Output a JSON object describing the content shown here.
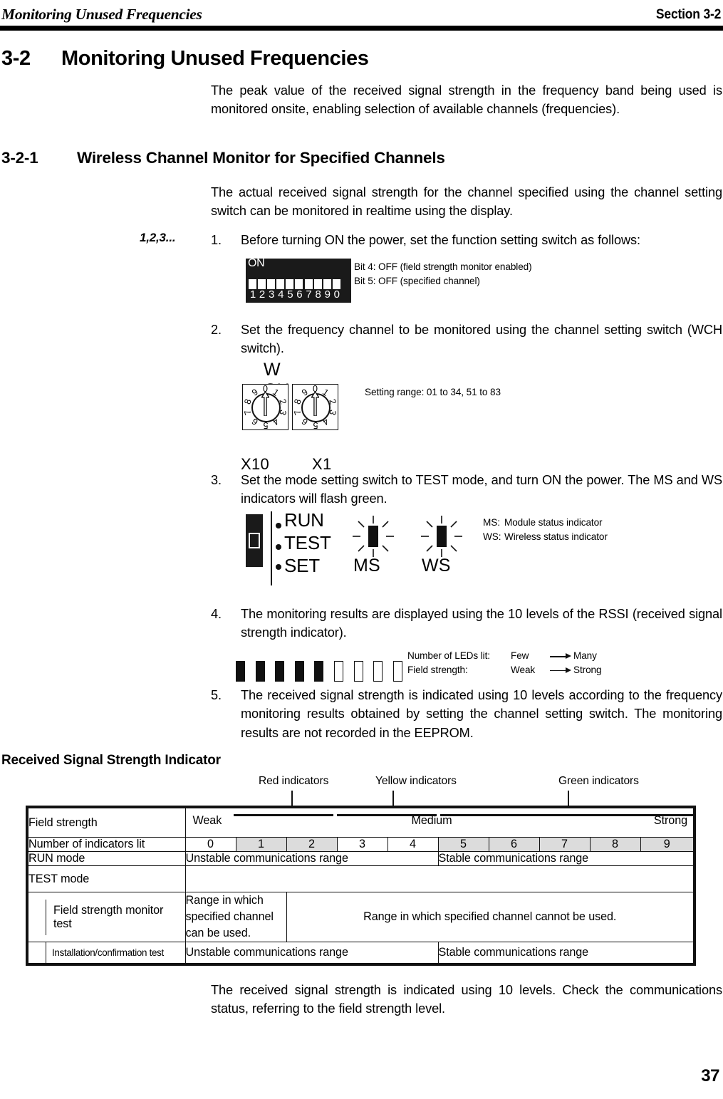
{
  "running_head": {
    "left": "Monitoring Unused Frequencies",
    "right": "Section 3-2"
  },
  "section": {
    "number": "3-2",
    "title": "Monitoring Unused Frequencies",
    "intro": "The peak value of the received signal strength in the frequency band being used is monitored onsite, enabling selection of available channels (frequencies)."
  },
  "subsection": {
    "number": "3-2-1",
    "title": "Wireless Channel Monitor for Specified Channels",
    "intro": "The actual received signal strength for the channel specified using the channel setting switch can be monitored in realtime using the display."
  },
  "steps_marker": "1,2,3...",
  "steps": [
    {
      "num": "1.",
      "text": "Before turning ON the power, set the function setting switch as follows:"
    },
    {
      "num": "2.",
      "text": "Set the frequency channel to be monitored using the channel setting switch (WCH switch)."
    },
    {
      "num": "3.",
      "text": "Set the mode setting switch to TEST mode, and turn ON the power. The MS and WS indicators will flash green."
    },
    {
      "num": "4.",
      "text": "The monitoring results are displayed using the 10 levels of the RSSI (received signal strength indicator)."
    },
    {
      "num": "5.",
      "text": "The received signal strength is indicated using 10 levels according to the frequency monitoring results obtained by setting the channel setting switch. The monitoring results are not recorded in the EEPROM."
    }
  ],
  "dip_switch": {
    "on_label": "ON",
    "pin_labels": [
      "1",
      "2",
      "3",
      "4",
      "5",
      "6",
      "7",
      "8",
      "9",
      "0"
    ],
    "notes": [
      "Bit 4: OFF (field strength monitor enabled)",
      "Bit 5: OFF (specified channel)"
    ]
  },
  "rotary_switch": {
    "title": "W CH",
    "digits": [
      "0",
      "1",
      "2",
      "3",
      "4",
      "5",
      "6",
      "7",
      "8",
      "9"
    ],
    "label_x10": "X10",
    "label_x1": "X1",
    "note": "Setting range: 01 to 34, 51 to 83"
  },
  "mode_switch": {
    "modes": [
      "RUN",
      "TEST",
      "SET"
    ],
    "indicator_labels": [
      "MS",
      "WS"
    ],
    "notes": [
      {
        "tag": "MS:",
        "text": "Module status indicator"
      },
      {
        "tag": "WS:",
        "text": "Wireless status indicator"
      }
    ]
  },
  "rssi_figure": {
    "leds_total": 9,
    "leds_lit": 5,
    "legend": [
      {
        "key": "Number of LEDs lit:",
        "from": "Few",
        "to": "Many"
      },
      {
        "key": "Field strength:",
        "from": "Weak",
        "to": "Strong"
      }
    ]
  },
  "table_title": "Received Signal Strength Indicator",
  "callouts": [
    {
      "label": "Red indicators"
    },
    {
      "label": "Yellow indicators"
    },
    {
      "label": "Green indicators"
    }
  ],
  "table": {
    "field_strength": {
      "row_label": "Field strength",
      "weak": "Weak",
      "medium": "Medium",
      "strong": "Strong"
    },
    "indicators": {
      "row_label": "Number of indicators lit",
      "values": [
        "0",
        "1",
        "2",
        "3",
        "4",
        "5",
        "6",
        "7",
        "8",
        "9"
      ],
      "shaded": [
        false,
        true,
        true,
        false,
        false,
        true,
        true,
        true,
        true,
        true
      ]
    },
    "run_mode": {
      "row_label": "RUN mode",
      "unstable": "Unstable communications range",
      "stable": "Stable communications range"
    },
    "test_mode": {
      "row_label": "TEST mode"
    },
    "field_strength_monitor_test": {
      "row_label": "Field strength monitor test",
      "can_be_used": "Range  in which specified channel can be used.",
      "cannot_be_used": "Range  in which specified channel cannot be used."
    },
    "installation_test": {
      "row_label": "Installation/confirmation test",
      "unstable": "Unstable communications range",
      "stable": "Stable communications range"
    }
  },
  "closing_text": "The received signal strength is indicated using 10 levels. Check the communications status, referring to the field strength level.",
  "page_number": "37"
}
